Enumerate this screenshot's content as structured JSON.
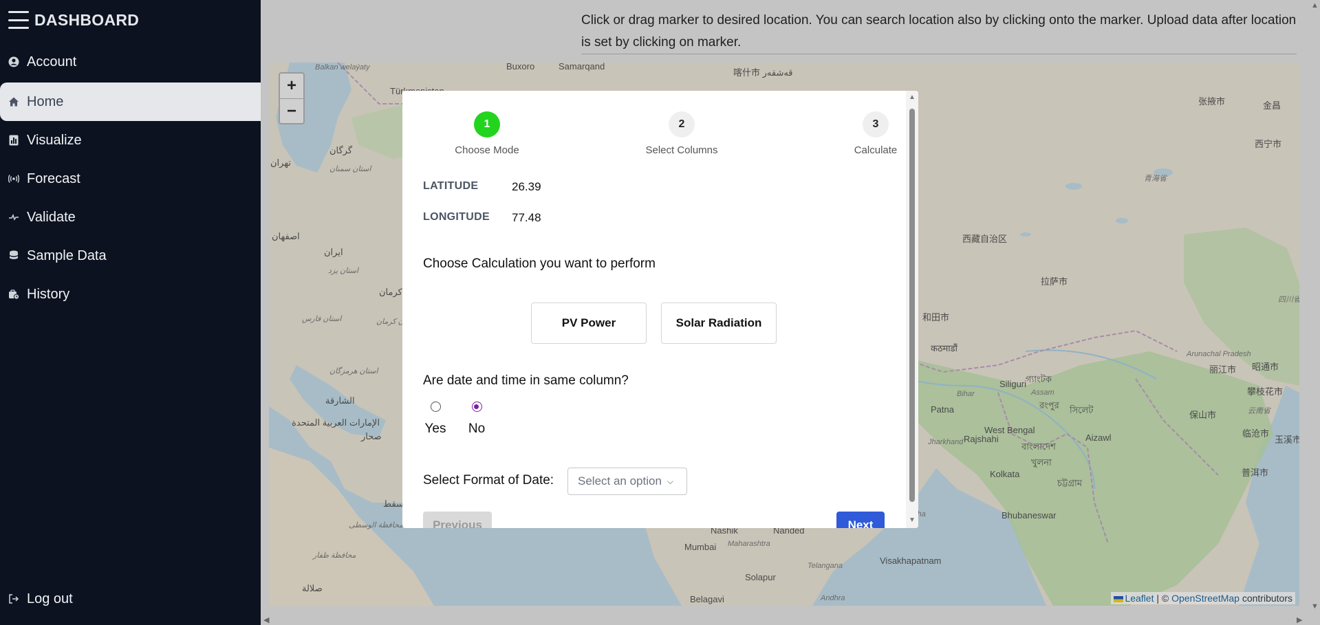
{
  "sidebar": {
    "brand": "DASHBOARD",
    "items": [
      {
        "label": "Account",
        "icon": "user-circle-icon"
      },
      {
        "label": "Home",
        "icon": "home-icon"
      },
      {
        "label": "Visualize",
        "icon": "chart-icon"
      },
      {
        "label": "Forecast",
        "icon": "broadcast-icon"
      },
      {
        "label": "Validate",
        "icon": "validate-icon"
      },
      {
        "label": "Sample Data",
        "icon": "database-icon"
      },
      {
        "label": "History",
        "icon": "history-icon"
      }
    ],
    "logout": "Log out",
    "active_item": "Home"
  },
  "main": {
    "instructions": "Click or drag marker to desired location. You can search location also by clicking onto the marker. Upload data after location is set by clicking on marker."
  },
  "map": {
    "zoom_in": "+",
    "zoom_out": "−",
    "attribution": {
      "leaflet": "Leaflet",
      "sep": " | © ",
      "osm": "OpenStreetMap",
      "suffix": " contributors"
    },
    "labels": [
      "Balkan welaýaty",
      "Buxoro",
      "Samarqand",
      "喀什市 قەشقەر",
      "Türkmenistan",
      "和田市",
      "拉萨市",
      "西藏自治区",
      "कठमाडौं",
      "Siliguri",
      "Assam",
      "Arunachal Pradesh",
      "Patna",
      "Bihar",
      "West Bengal",
      "Jharkhand",
      "Kolkata",
      "Bhubaneswar",
      "Odisha",
      "Aizawl",
      "Nashik",
      "Nanded",
      "Mumbai",
      "Maharashtra",
      "Visakhapatnam",
      "Telangana",
      "Solapur",
      "Belagavi",
      "Andhra",
      "张掖市",
      "金昌",
      "西宁市",
      "青海省",
      "四川省",
      "丽江市",
      "昭通市",
      "攀枝花市",
      "保山市",
      "云南省",
      "临沧市",
      "玉溪市",
      "普洱市",
      "تهران",
      "استان سمنان",
      "اصفهان",
      "ایران",
      "استان یزد",
      "کرمان",
      "استان فارس",
      "استان کرمان",
      "استان هرمزگان",
      "الشارقة",
      "الإمارات العربية المتحدة",
      "صحار",
      "مسقط",
      "محافظة الوسطى",
      "محافظة ظفار",
      "صلالة",
      "گرگان",
      "গ্যাংটক",
      "রংপুর",
      "বাংলাদেশ",
      "খুলনা",
      "চট্টগ্রাম",
      "সিলেট",
      "Rajshahi"
    ],
    "colors": {
      "water": "#a7bcc6",
      "land": "#c9c4b8",
      "green": "#9bb98e",
      "border": "#a88ba8"
    }
  },
  "modal": {
    "steps": [
      {
        "number": "1",
        "label": "Choose Mode",
        "state": "done"
      },
      {
        "number": "2",
        "label": "Select Columns",
        "state": "pending"
      },
      {
        "number": "3",
        "label": "Calculate",
        "state": "pending"
      }
    ],
    "latitude": {
      "label": "LATITUDE",
      "value": "26.39"
    },
    "longitude": {
      "label": "LONGITUDE",
      "value": "77.48"
    },
    "calc_prompt": "Choose Calculation you want to perform",
    "calc_options": [
      "PV Power",
      "Solar Radiation"
    ],
    "datetime_question": "Are date and time in same column?",
    "radio": {
      "yes": "Yes",
      "no": "No",
      "selected": "No"
    },
    "date_format_label": "Select Format of Date:",
    "date_format_select": "Select an option",
    "previous": "Previous",
    "next": "Next"
  }
}
